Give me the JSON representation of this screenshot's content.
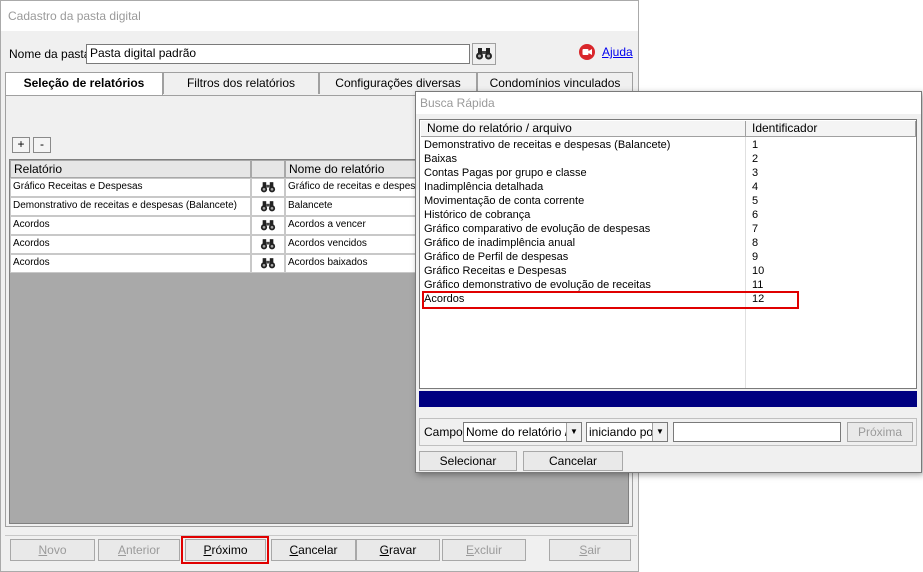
{
  "window": {
    "title": "Cadastro da pasta digital"
  },
  "header": {
    "folder_label": "Nome da pasta:",
    "folder_value": "Pasta digital padrão",
    "help_label": "Ajuda"
  },
  "tabs": [
    {
      "label": "Seleção de relatórios",
      "active": true
    },
    {
      "label": "Filtros dos relatórios",
      "active": false
    },
    {
      "label": "Configurações diversas",
      "active": false
    },
    {
      "label": "Condomínios vinculados",
      "active": false
    }
  ],
  "grid": {
    "add_label": "+",
    "remove_label": "-",
    "col_report": "Relatório",
    "col_name": "Nome do relatório",
    "rows": [
      {
        "report": "Gráfico Receitas e Despesas",
        "name": "Gráfico de receitas e despesas"
      },
      {
        "report": "Demonstrativo de receitas e despesas (Balancete)",
        "name": "Balancete"
      },
      {
        "report": "Acordos",
        "name": "Acordos a vencer"
      },
      {
        "report": "Acordos",
        "name": "Acordos vencidos"
      },
      {
        "report": "Acordos",
        "name": "Acordos baixados"
      }
    ]
  },
  "footer": {
    "new": {
      "pre": "",
      "key": "N",
      "post": "ovo"
    },
    "prev": {
      "pre": "",
      "key": "A",
      "post": "nterior"
    },
    "next": {
      "pre": "",
      "key": "P",
      "post": "róximo"
    },
    "cancel": {
      "pre": "",
      "key": "C",
      "post": "ancelar"
    },
    "save": {
      "pre": "",
      "key": "G",
      "post": "ravar"
    },
    "delete": {
      "pre": "",
      "key": "E",
      "post": "xcluir"
    },
    "exit": {
      "pre": "",
      "key": "S",
      "post": "air"
    }
  },
  "dialog": {
    "title": "Busca Rápida",
    "col_name": "Nome do relatório / arquivo",
    "col_id": "Identificador",
    "items": [
      {
        "name": "Demonstrativo de receitas e despesas (Balancete)",
        "id": "1"
      },
      {
        "name": "Baixas",
        "id": "2"
      },
      {
        "name": "Contas Pagas por grupo e classe",
        "id": "3"
      },
      {
        "name": "Inadimplência detalhada",
        "id": "4"
      },
      {
        "name": "Movimentação de conta corrente",
        "id": "5"
      },
      {
        "name": "Histórico de cobrança",
        "id": "6"
      },
      {
        "name": "Gráfico comparativo de evolução de despesas",
        "id": "7"
      },
      {
        "name": "Gráfico de inadimplência anual",
        "id": "8"
      },
      {
        "name": "Gráfico de Perfil de despesas",
        "id": "9"
      },
      {
        "name": "Gráfico Receitas e Despesas",
        "id": "10"
      },
      {
        "name": "Gráfico demonstrativo de evolução de receitas",
        "id": "11"
      },
      {
        "name": "Acordos",
        "id": "12",
        "highlighted": true
      }
    ],
    "field_label": "Campo:",
    "field_value": "Nome do relatório / a",
    "match_value": "iniciando por",
    "search_value": "",
    "next_label": "Próxima",
    "select_label": "Selecionar",
    "cancel_label": "Cancelar"
  },
  "colors": {
    "accent": "#000080",
    "highlight": "#e00000",
    "help_icon": "#d9262b",
    "link": "#0000ee"
  },
  "icons": {
    "search": "binoculars-icon",
    "help": "help-icon"
  }
}
